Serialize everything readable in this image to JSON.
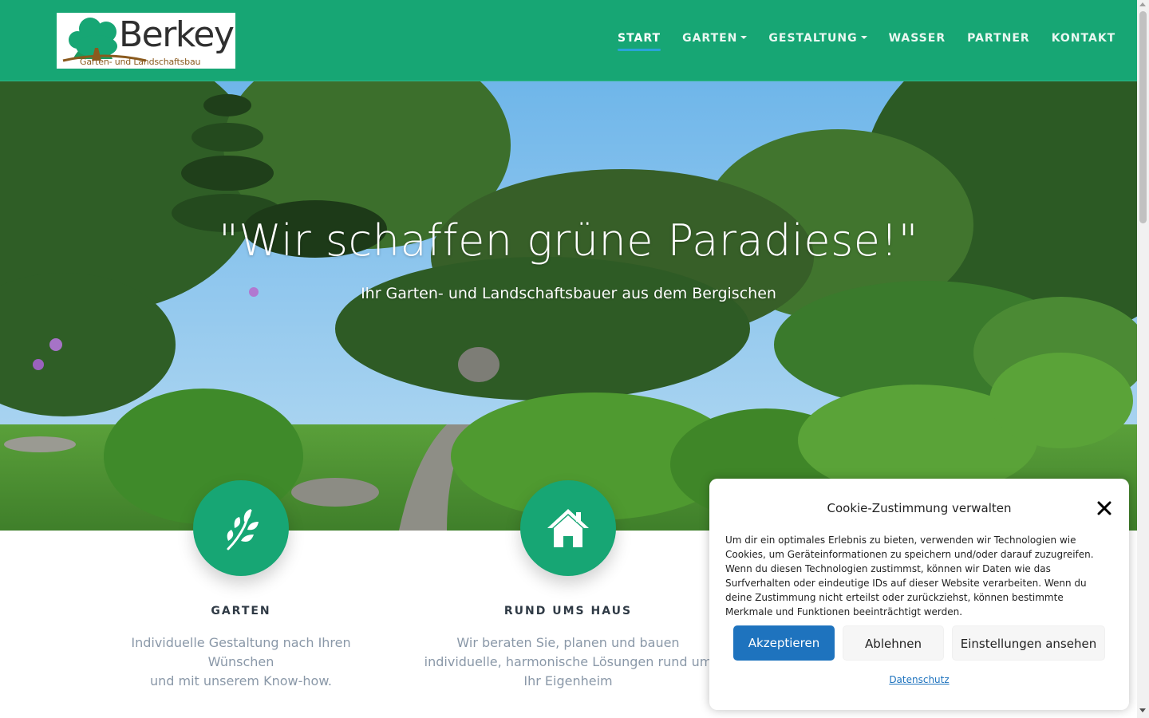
{
  "brand": {
    "logo_word": "Berkey",
    "logo_sub": "Garten- und Landschaftsbau"
  },
  "nav": {
    "items": [
      {
        "label": "START",
        "active": true,
        "dropdown": false
      },
      {
        "label": "GARTEN",
        "active": false,
        "dropdown": true
      },
      {
        "label": "GESTALTUNG",
        "active": false,
        "dropdown": true
      },
      {
        "label": "WASSER",
        "active": false,
        "dropdown": false
      },
      {
        "label": "PARTNER",
        "active": false,
        "dropdown": false
      },
      {
        "label": "KONTAKT",
        "active": false,
        "dropdown": false
      }
    ]
  },
  "hero": {
    "title": "\"Wir schaffen grüne Paradiese!\"",
    "subtitle": "Ihr Garten- und Landschaftsbauer aus dem Bergischen"
  },
  "features": [
    {
      "icon": "leaf-icon",
      "title": "GARTEN",
      "text_lines": [
        "Individuelle Gestaltung nach Ihren Wünschen",
        "und mit unserem Know-how."
      ]
    },
    {
      "icon": "home-icon",
      "title": "RUND UMS HAUS",
      "text_lines": [
        "Wir beraten Sie, planen und bauen",
        "individuelle, harmonische Lösungen rund um",
        "Ihr Eigenheim"
      ]
    }
  ],
  "cookie": {
    "title": "Cookie-Zustimmung verwalten",
    "text": "Um dir ein optimales Erlebnis zu bieten, verwenden wir Technologien wie Cookies, um Geräteinformationen zu speichern und/oder darauf zuzugreifen. Wenn du diesen Technologien zustimmst, können wir Daten wie das Surfverhalten oder eindeutige IDs auf dieser Website verarbeiten. Wenn du deine Zustimmung nicht erteilst oder zurückziehst, können bestimmte Merkmale und Funktionen beeinträchtigt werden.",
    "accept_label": "Akzeptieren",
    "deny_label": "Ablehnen",
    "settings_label": "Einstellungen ansehen",
    "privacy_link": "Datenschutz"
  },
  "colors": {
    "brand_green": "#17a674",
    "accent_blue": "#1e73be",
    "active_underline": "#2aa3d9"
  }
}
